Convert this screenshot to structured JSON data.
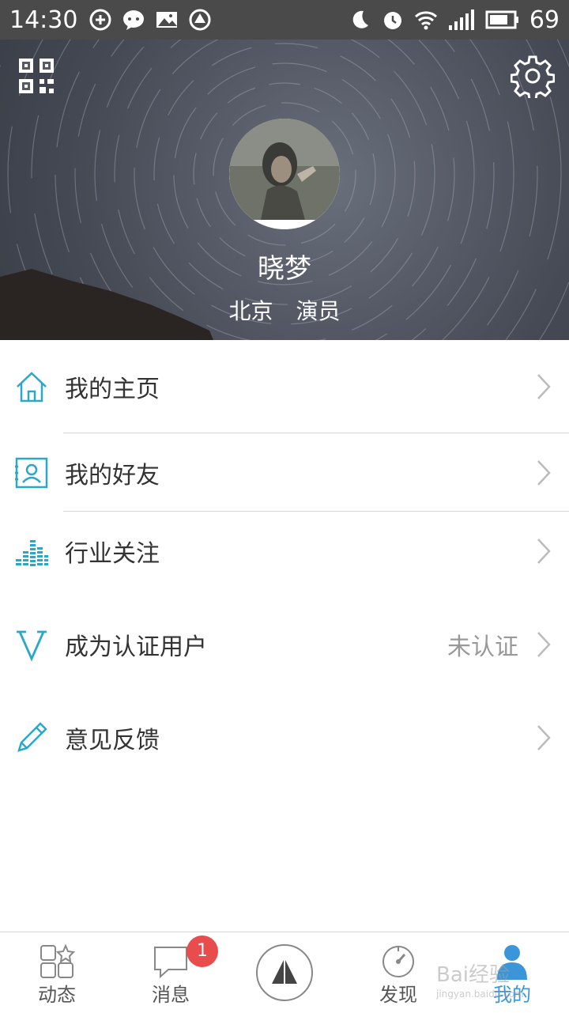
{
  "status_bar": {
    "time": "14:30",
    "battery": "69",
    "left_icons": [
      "sync-icon",
      "chat-bubble-icon",
      "image-icon",
      "app-icon"
    ],
    "right_icons": [
      "moon-icon",
      "alarm-icon",
      "wifi-icon",
      "signal-4g-icon",
      "battery-icon"
    ]
  },
  "profile": {
    "name": "晓梦",
    "city": "北京",
    "role": "演员"
  },
  "menu": {
    "items": [
      {
        "label": "我的主页",
        "icon": "home-icon"
      },
      {
        "label": "我的好友",
        "icon": "contact-card-icon"
      },
      {
        "label": "行业关注",
        "icon": "equalizer-icon"
      },
      {
        "label": "成为认证用户",
        "icon": "v-icon",
        "value": "未认证"
      },
      {
        "label": "意见反馈",
        "icon": "pencil-icon"
      }
    ]
  },
  "bottom_nav": {
    "tabs": [
      {
        "label": "动态",
        "icon": "grid-star-icon"
      },
      {
        "label": "消息",
        "icon": "message-icon",
        "badge": "1"
      },
      {
        "label": "",
        "icon": "sail-icon"
      },
      {
        "label": "发现",
        "icon": "compass-icon"
      },
      {
        "label": "我的",
        "icon": "person-icon",
        "active": true
      }
    ]
  },
  "watermark": {
    "text": "Bai经验",
    "sub": "jingyan.baidu.com"
  },
  "colors": {
    "accent": "#3a96d8",
    "icon_teal": "#2aa7c9",
    "badge": "#e84c4c",
    "status_bar": "#4a4a4a"
  }
}
